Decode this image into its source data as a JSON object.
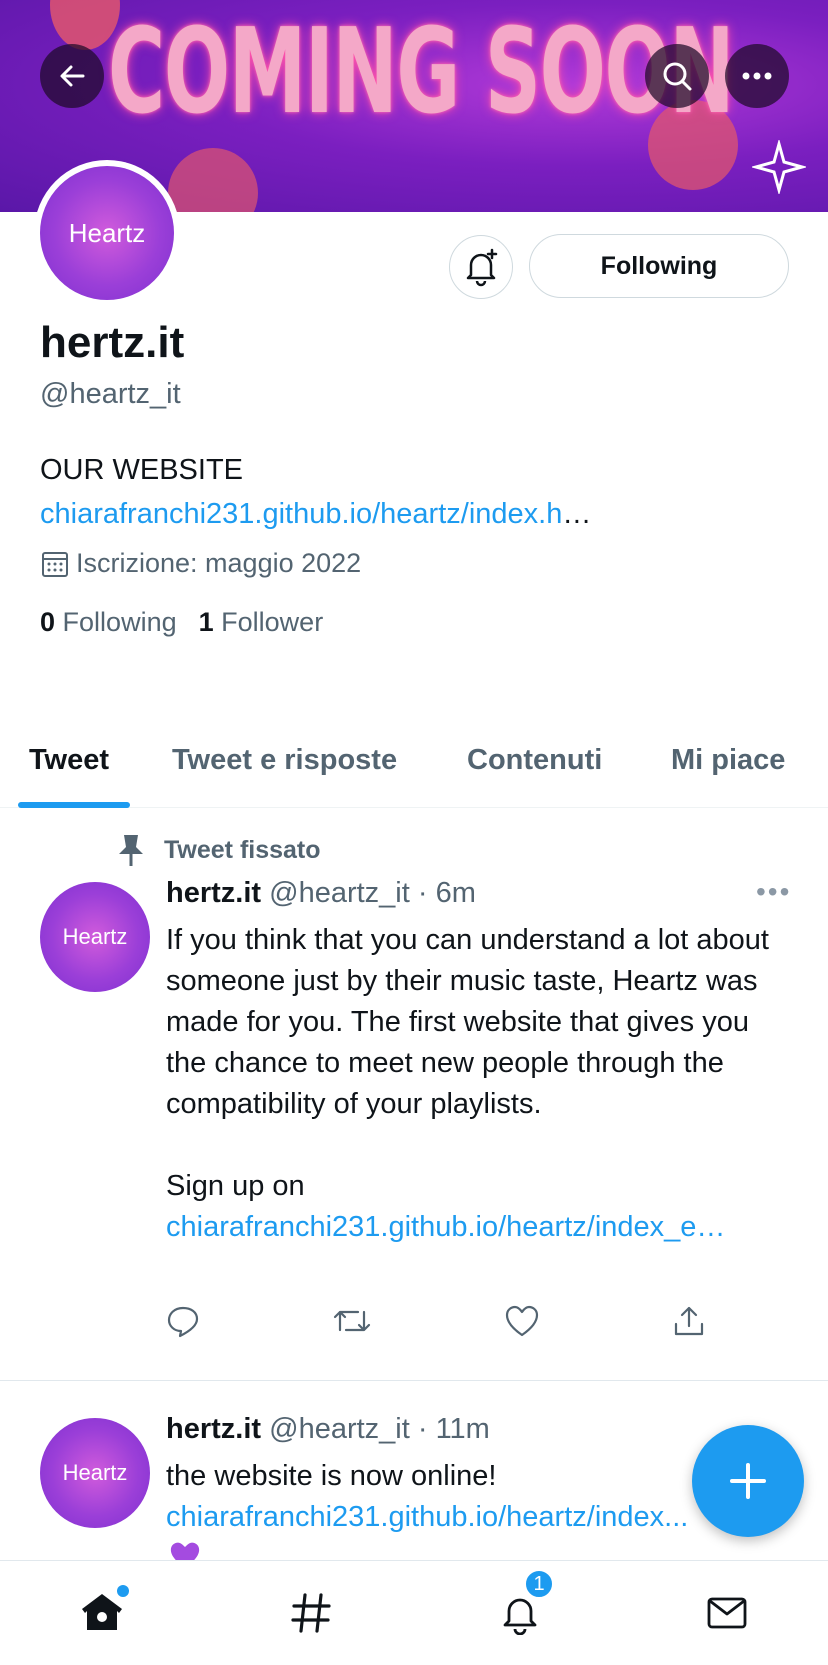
{
  "banner": {
    "text": "COMING SOON"
  },
  "header": {
    "back_icon": "arrow-left-icon",
    "search_icon": "search-icon",
    "more_icon": "more-horizontal-icon"
  },
  "profile": {
    "avatar_text": "Heartz",
    "display_name": "hertz.it",
    "handle": "@heartz_it",
    "bio_prefix": "OUR WEBSITE ",
    "bio_link": "chiarafranchi231.github.io/heartz/index.h",
    "bio_ellipsis": "…",
    "joined": "Iscrizione: maggio 2022",
    "following_count": "0",
    "following_label": "Following",
    "followers_count": "1",
    "followers_label": "Follower",
    "follow_button": "Following"
  },
  "tabs": [
    "Tweet",
    "Tweet e risposte",
    "Contenuti",
    "Mi piace"
  ],
  "tweets": [
    {
      "pinned_label": "Tweet fissato",
      "name": "hertz.it",
      "handle": "@heartz_it",
      "time": "· 6m",
      "text": "If you think that you can understand a lot about someone just by their music taste, Heartz was made for you. The first website that gives you the chance to meet new people through the compatibility of your playlists.",
      "signup_prefix": "Sign up on ",
      "signup_link": "chiarafranchi231.github.io/heartz/index_e…"
    },
    {
      "name": "hertz.it",
      "handle": "@heartz_it",
      "time": "· 11m",
      "text": "the website is now online!",
      "link": "chiarafranchi231.github.io/heartz/index..."
    }
  ],
  "nav": {
    "notifications_badge": "1"
  },
  "colors": {
    "accent": "#1d9bf0",
    "text": "#0f1419",
    "muted": "#536471"
  }
}
